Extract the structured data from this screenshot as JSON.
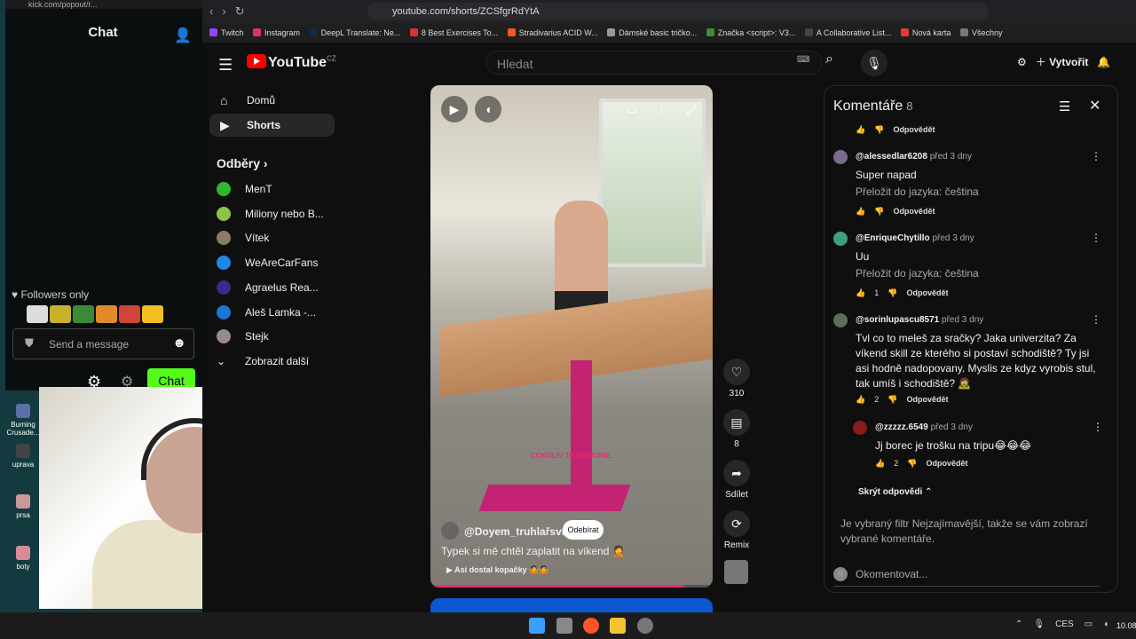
{
  "desktop": {
    "icons": [
      "Burning Crusade...",
      "uprava",
      "prsa",
      "boty"
    ]
  },
  "kick": {
    "url": "kick.com/popout/r...",
    "title": "Chat",
    "followers_only": "Followers only",
    "message_placeholder": "Send a message",
    "chat_button": "Chat"
  },
  "browser": {
    "url": "youtube.com/shorts/ZCSfgrRdYtA",
    "bookmarks": [
      "Twitch",
      "Instagram",
      "DeepL Translate: Ne...",
      "8 Best Exercises To...",
      "Stradivarius ACID W...",
      "Dámské basic tričko...",
      "Značka <script>: V3...",
      "A Collaborative List...",
      "Nová karta",
      "Všechny"
    ]
  },
  "youtube": {
    "logo": "YouTube",
    "country": "CZ",
    "search_placeholder": "Hledat",
    "create_label": "Vytvořit",
    "nav": [
      {
        "label": "Domů",
        "icon": "home-icon"
      },
      {
        "label": "Shorts",
        "icon": "shorts-icon"
      }
    ],
    "subs_title": "Odběry",
    "subscriptions": [
      {
        "name": "MenT",
        "color": "#2eb82e"
      },
      {
        "name": "Miliony nebo B...",
        "color": "#4caf50"
      },
      {
        "name": "Vítek",
        "color": "#8a7a6a"
      },
      {
        "name": "WeAreCarFans",
        "color": "#1e88e5"
      },
      {
        "name": "Agraelus Rea...",
        "color": "#3b2a88"
      },
      {
        "name": "Aleš Lamka -...",
        "color": "#1976d2"
      },
      {
        "name": "Stejk",
        "color": "#9a8b8b"
      }
    ],
    "show_more": "Zobrazit další"
  },
  "short": {
    "caption": "COKOLIV TĚ NAPADNE.",
    "channel": "@Doyem_truhlařsví",
    "subscribe": "Odebírat",
    "title": "Typek si mě chtěl zaplatit na víkend",
    "song": "Asi dostal kopačky",
    "progress": 0.9,
    "likes": "310",
    "comments": "8",
    "share": "Sdílet",
    "remix": "Remix"
  },
  "comments_panel": {
    "title": "Komentáře",
    "count": "8",
    "reply_label": "Odpovědět",
    "translate_label": "Přeložit do jazyka: čeština",
    "comments": [
      {
        "author": "@alessedlar6208",
        "time": "před 3 dny",
        "text": "Super napad",
        "likes": "",
        "color": "#7a6b8c"
      },
      {
        "author": "@EnriqueChytillo",
        "time": "před 3 dny",
        "text": "Uu",
        "likes": "1",
        "color": "#3aa17e"
      },
      {
        "author": "@sorinlupascu8571",
        "time": "před 3 dny",
        "text": "Tvl co to meleš za sračky? Jaka univerzita? Za víkend skill ze kterého si postaví schodiště? Ty jsi asi hodně nadopovany. Myslis ze kdyz vyrobis stul, tak umíš i schodiště? 🧟",
        "likes": "2",
        "color": "#5b6f5b"
      },
      {
        "author": "@zzzzz.6549",
        "time": "před 3 dny",
        "text": "Jj borec je trošku na tripu😂😂😂",
        "likes": "2",
        "color": "#8b1a1a"
      }
    ],
    "hide_replies": "Skrýt odpovědi",
    "filter_note": "Je vybraný filtr Nejzajímavější, takže se vám zobrazí vybrané komentáře.",
    "input_placeholder": "Okomentovat..."
  },
  "taskbar": {
    "lang": "CES",
    "clock": "10.08"
  }
}
